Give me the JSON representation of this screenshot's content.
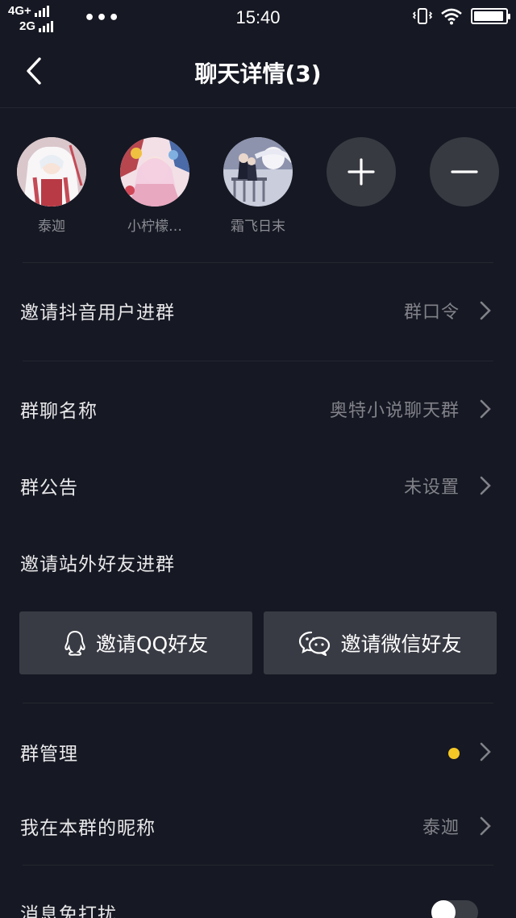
{
  "status_bar": {
    "network_1": "4G+",
    "network_2": "2G",
    "more": "•••",
    "time": "15:40",
    "battery_level": 0.95
  },
  "header": {
    "title": "聊天详情(3)",
    "back_icon": "chevron-left-icon"
  },
  "members": [
    {
      "name": "泰迦"
    },
    {
      "name": "小柠檬…"
    },
    {
      "name": "霜飞日末"
    }
  ],
  "member_actions": {
    "add_icon": "plus-icon",
    "remove_icon": "minus-icon"
  },
  "settings": {
    "invite_douyin": {
      "label": "邀请抖音用户进群",
      "value": "群口令"
    },
    "group_name": {
      "label": "群聊名称",
      "value": "奥特小说聊天群"
    },
    "announcement": {
      "label": "群公告",
      "value": "未设置"
    },
    "invite_outside": {
      "label": "邀请站外好友进群"
    },
    "invite_qq": {
      "label": "邀请QQ好友",
      "icon": "qq-icon"
    },
    "invite_wechat": {
      "label": "邀请微信好友",
      "icon": "wechat-icon"
    },
    "group_manage": {
      "label": "群管理",
      "indicator_color": "#f6c826"
    },
    "nickname": {
      "label": "我在本群的昵称",
      "value": "泰迦"
    },
    "do_not_disturb": {
      "label": "消息免打扰",
      "enabled": false
    }
  },
  "colors": {
    "background": "#161823",
    "button_bg": "#393b44",
    "accent_dot": "#f6c826"
  }
}
